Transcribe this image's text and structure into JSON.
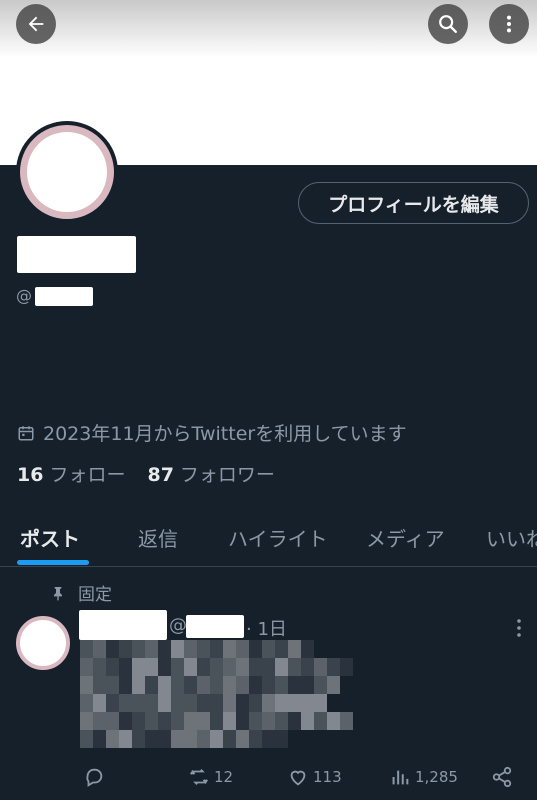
{
  "profile": {
    "edit_button_label": "プロフィールを編集",
    "handle_prefix": "@",
    "joined_text": "2023年11月からTwitterを利用しています",
    "following_count": "16",
    "following_label": "フォロー",
    "followers_count": "87",
    "followers_label": "フォロワー"
  },
  "tabs": [
    "ポスト",
    "返信",
    "ハイライト",
    "メディア",
    "いいね"
  ],
  "pinned_label": "固定",
  "tweet": {
    "at": "@",
    "time": "· 1日",
    "stats": {
      "retweets": "12",
      "likes": "113",
      "views": "1,285"
    }
  },
  "colors": {
    "background": "#15202b",
    "accent": "#1d9bf0",
    "muted_text": "#8b98a5"
  },
  "icons": [
    "back-arrow-icon",
    "search-icon",
    "more-vertical-icon",
    "calendar-icon",
    "pin-icon",
    "reply-icon",
    "retweet-icon",
    "like-icon",
    "views-icon",
    "share-icon"
  ]
}
